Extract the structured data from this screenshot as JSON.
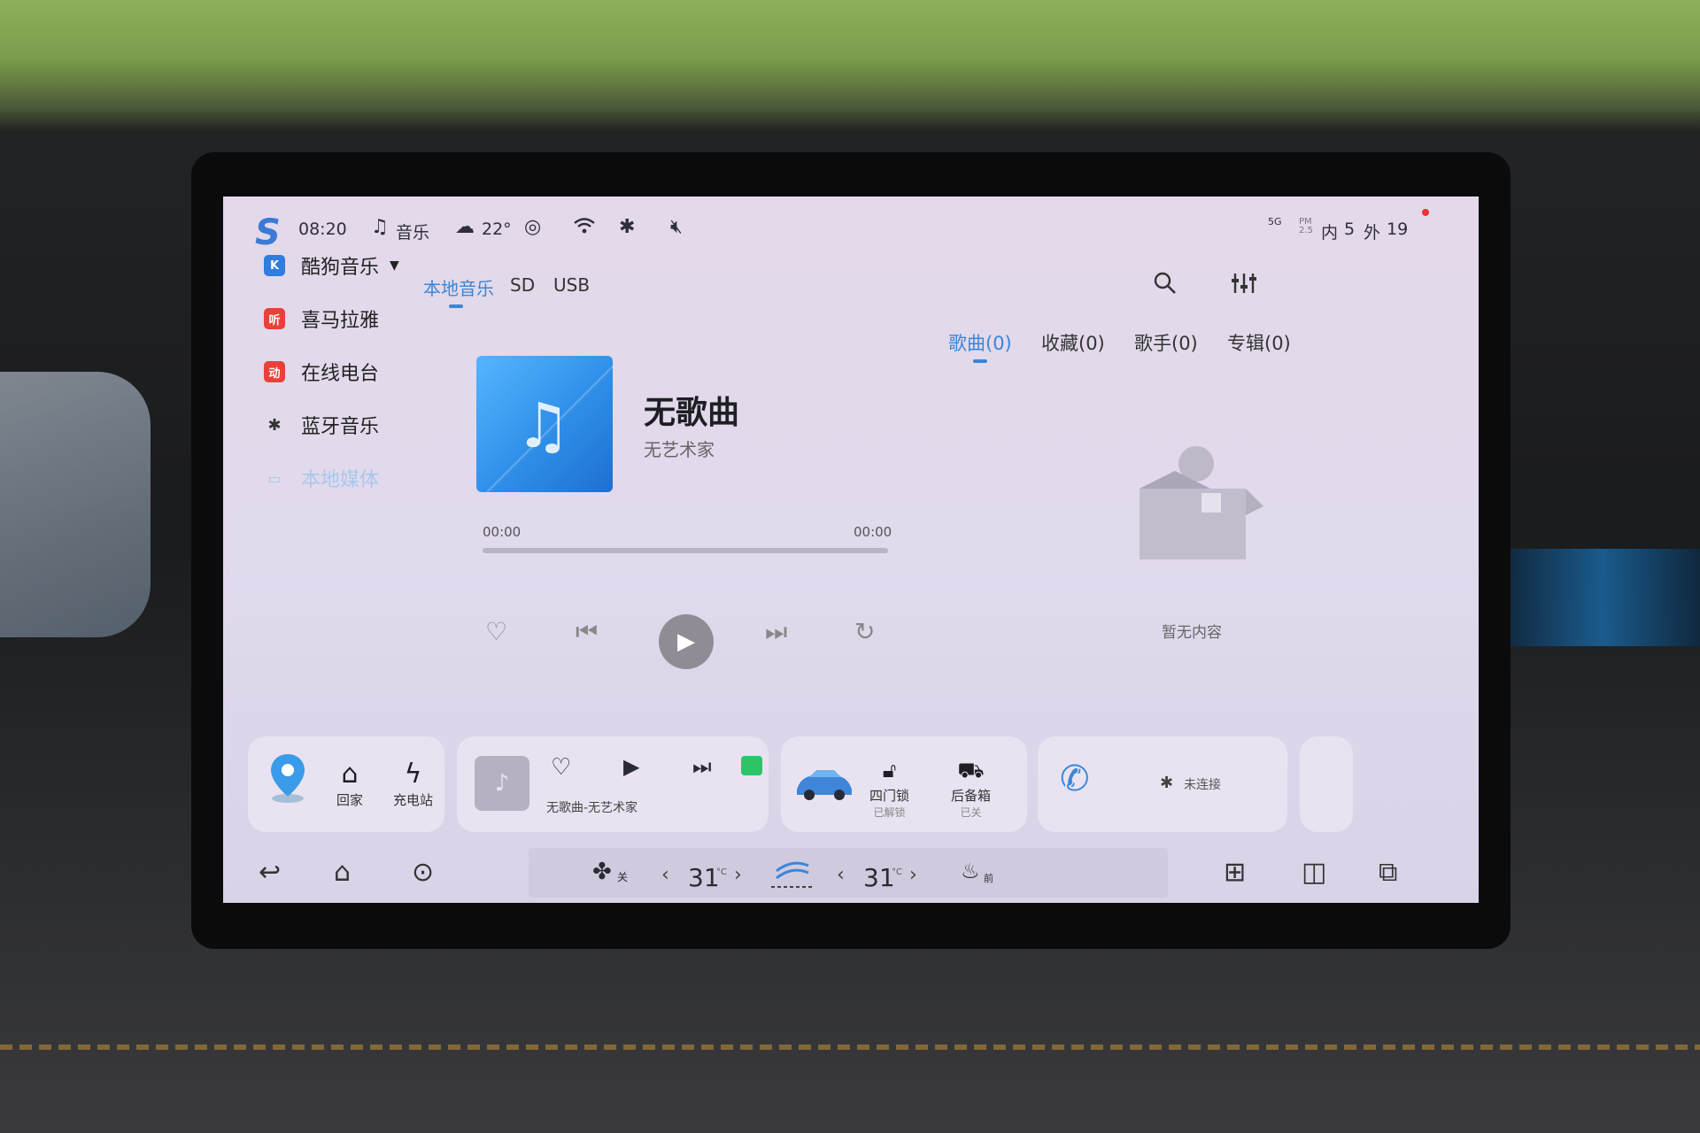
{
  "status_bar": {
    "logo": "S",
    "time": "08:20",
    "now_playing_label": "音乐",
    "weather_temp": "22°",
    "inside_label": "内",
    "inside_temp": "5",
    "outside_label": "外",
    "outside_temp": "19",
    "pm_label": "PM 2.5",
    "signal_label": "5G"
  },
  "sidebar": {
    "items": [
      {
        "label": "酷狗音乐",
        "icon": "K"
      },
      {
        "label": "喜马拉雅",
        "icon": "听"
      },
      {
        "label": "在线电台",
        "icon": "动"
      },
      {
        "label": "蓝牙音乐",
        "icon": "bluetooth-icon"
      },
      {
        "label": "本地媒体",
        "icon": "folder-icon"
      }
    ]
  },
  "source_tabs": {
    "items": [
      "本地音乐",
      "SD",
      "USB"
    ],
    "active_index": 0
  },
  "player": {
    "title": "无歌曲",
    "artist": "无艺术家",
    "time_current": "00:00",
    "time_total": "00:00",
    "progress": 0
  },
  "category_tabs": {
    "items": [
      "歌曲(0)",
      "收藏(0)",
      "歌手(0)",
      "专辑(0)"
    ],
    "active_index": 0
  },
  "empty_state": {
    "text": "暂无内容"
  },
  "dock": {
    "home_label": "回家",
    "charging_label": "充电站",
    "media_label": "无歌曲-无艺术家",
    "door_lock_label": "四门锁",
    "door_lock_status": "已解锁",
    "trunk_label": "后备箱",
    "trunk_status": "已关",
    "phone_status": "未连接"
  },
  "bottom_bar": {
    "fan_label": "关",
    "left_temp": "31",
    "right_temp": "31",
    "temp_unit": "°C",
    "defrost_label": "前"
  },
  "colors": {
    "accent": "#3a86d8",
    "screen_bg": "#e1d9ec"
  }
}
